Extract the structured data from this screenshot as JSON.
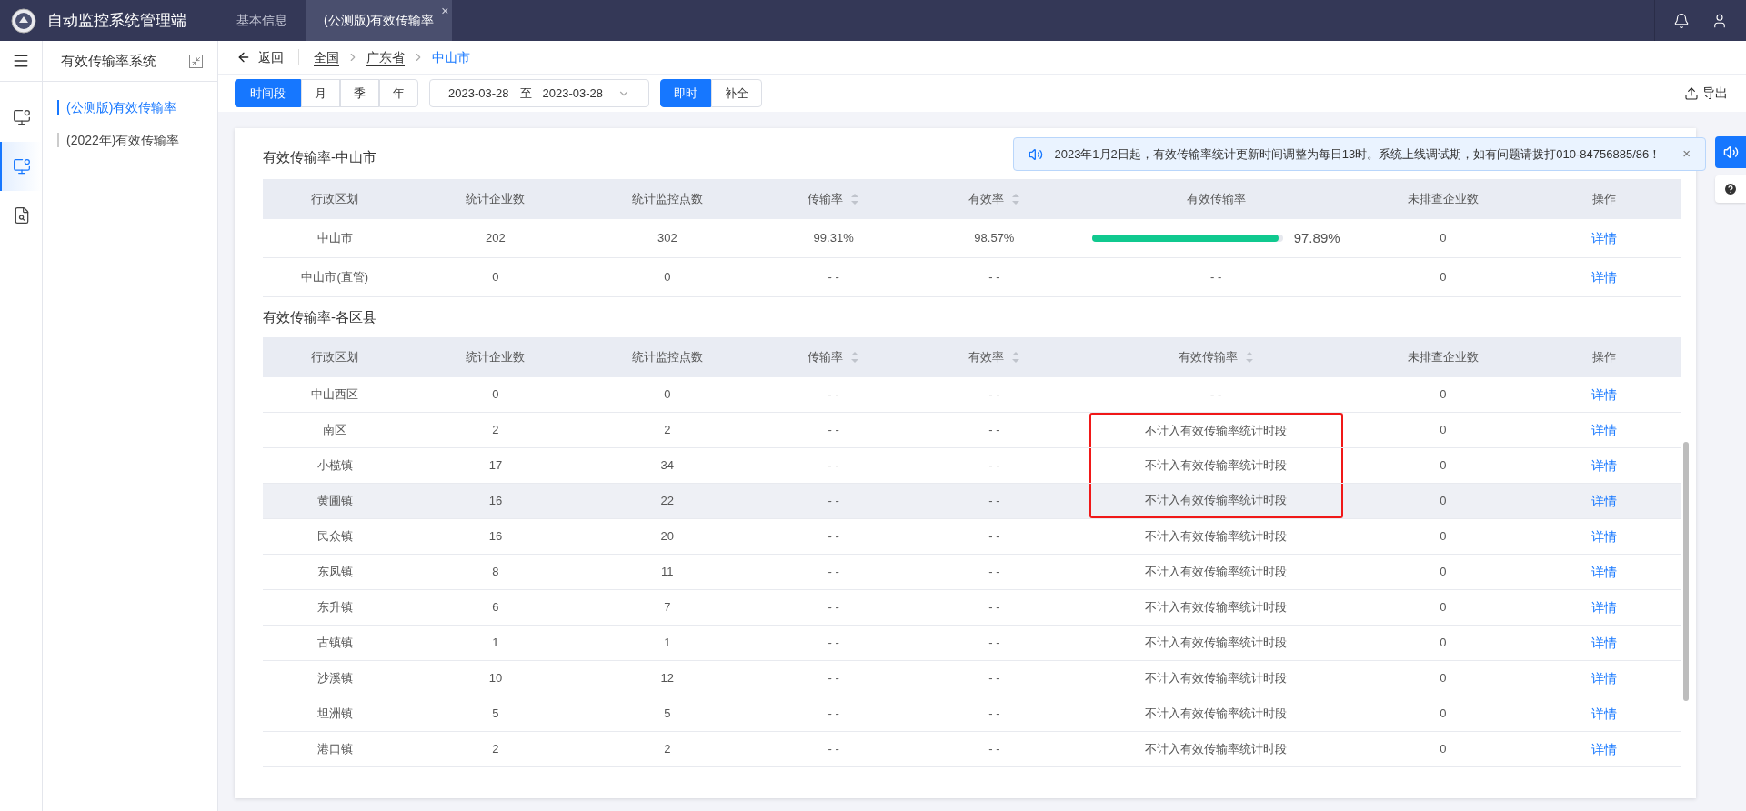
{
  "app": {
    "title": "自动监控系统管理端"
  },
  "tabs": [
    {
      "label": "基本信息",
      "selected": false
    },
    {
      "label": "(公测版)有效传输率",
      "selected": true,
      "close": "×"
    }
  ],
  "rail": [
    {
      "selected": false,
      "kind": "monitor"
    },
    {
      "selected": true,
      "kind": "monitor"
    },
    {
      "selected": false,
      "kind": "report"
    }
  ],
  "sidebar": {
    "title": "有效传输率系统",
    "items": [
      {
        "label": "(公测版)有效传输率",
        "selected": true
      },
      {
        "label": "(2022年)有效传输率",
        "selected": false
      }
    ]
  },
  "breadcrumb": {
    "back": "返回",
    "items": [
      {
        "label": "全国",
        "current": false
      },
      {
        "label": "广东省",
        "current": false
      },
      {
        "label": "中山市",
        "current": true
      }
    ]
  },
  "period_tabs": [
    {
      "label": "时间段",
      "selected": true
    },
    {
      "label": "月",
      "selected": false
    },
    {
      "label": "季",
      "selected": false
    },
    {
      "label": "年",
      "selected": false
    }
  ],
  "date_range": {
    "start": "2023-03-28",
    "separator": "至",
    "end": "2023-03-28"
  },
  "mode_tabs": [
    {
      "label": "即时",
      "selected": true
    },
    {
      "label": "补全",
      "selected": false
    }
  ],
  "export": "导出",
  "notice": {
    "text": "2023年1月2日起，有效传输率统计更新时间调整为每日13时。系统上线调试期，如有问题请拨打010-84756885/86！",
    "close": "×"
  },
  "tables": [
    {
      "title": "有效传输率-中山市",
      "columns": [
        {
          "label": "行政区划",
          "sortable": false
        },
        {
          "label": "统计企业数",
          "sortable": false
        },
        {
          "label": "统计监控点数",
          "sortable": false
        },
        {
          "label": "传输率",
          "sortable": true
        },
        {
          "label": "有效率",
          "sortable": true
        },
        {
          "label": "有效传输率",
          "sortable": false
        },
        {
          "label": "未排查企业数",
          "sortable": false
        },
        {
          "label": "操作",
          "sortable": false
        }
      ],
      "rows": [
        {
          "cells": [
            "中山市",
            "202",
            "302",
            "99.31%",
            "98.57%"
          ],
          "effective": {
            "text": "97.89%",
            "level": 0.9789
          },
          "unchecked": "0",
          "action": "详情"
        },
        {
          "cells": [
            "中山市(直管)",
            "0",
            "0",
            "- -",
            "- -"
          ],
          "effective": {
            "text": "- -"
          },
          "unchecked": "0",
          "action": "详情"
        }
      ]
    },
    {
      "title": "有效传输率-各区县",
      "columns": [
        {
          "label": "行政区划",
          "sortable": false
        },
        {
          "label": "统计企业数",
          "sortable": false
        },
        {
          "label": "统计监控点数",
          "sortable": false
        },
        {
          "label": "传输率",
          "sortable": true
        },
        {
          "label": "有效率",
          "sortable": true
        },
        {
          "label": "有效传输率",
          "sortable": true
        },
        {
          "label": "未排查企业数",
          "sortable": false
        },
        {
          "label": "操作",
          "sortable": false
        }
      ],
      "rows": [
        {
          "cells": [
            "中山西区",
            "0",
            "0",
            "- -",
            "- -"
          ],
          "effective": {
            "text": "- -"
          },
          "unchecked": "0",
          "action": "详情",
          "hovered": false,
          "highlighted": false
        },
        {
          "cells": [
            "南区",
            "2",
            "2",
            "- -",
            "- -"
          ],
          "effective": {
            "text": "不计入有效传输率统计时段"
          },
          "unchecked": "0",
          "action": "详情",
          "hovered": false,
          "highlighted": true
        },
        {
          "cells": [
            "小榄镇",
            "17",
            "34",
            "- -",
            "- -"
          ],
          "effective": {
            "text": "不计入有效传输率统计时段"
          },
          "unchecked": "0",
          "action": "详情",
          "hovered": false,
          "highlighted": true
        },
        {
          "cells": [
            "黄圃镇",
            "16",
            "22",
            "- -",
            "- -"
          ],
          "effective": {
            "text": "不计入有效传输率统计时段"
          },
          "unchecked": "0",
          "action": "详情",
          "hovered": true,
          "highlighted": true
        },
        {
          "cells": [
            "民众镇",
            "16",
            "20",
            "- -",
            "- -"
          ],
          "effective": {
            "text": "不计入有效传输率统计时段"
          },
          "unchecked": "0",
          "action": "详情",
          "hovered": false,
          "highlighted": false
        },
        {
          "cells": [
            "东凤镇",
            "8",
            "11",
            "- -",
            "- -"
          ],
          "effective": {
            "text": "不计入有效传输率统计时段"
          },
          "unchecked": "0",
          "action": "详情",
          "hovered": false,
          "highlighted": false
        },
        {
          "cells": [
            "东升镇",
            "6",
            "7",
            "- -",
            "- -"
          ],
          "effective": {
            "text": "不计入有效传输率统计时段"
          },
          "unchecked": "0",
          "action": "详情",
          "hovered": false,
          "highlighted": false
        },
        {
          "cells": [
            "古镇镇",
            "1",
            "1",
            "- -",
            "- -"
          ],
          "effective": {
            "text": "不计入有效传输率统计时段"
          },
          "unchecked": "0",
          "action": "详情",
          "hovered": false,
          "highlighted": false
        },
        {
          "cells": [
            "沙溪镇",
            "10",
            "12",
            "- -",
            "- -"
          ],
          "effective": {
            "text": "不计入有效传输率统计时段"
          },
          "unchecked": "0",
          "action": "详情",
          "hovered": false,
          "highlighted": false
        },
        {
          "cells": [
            "坦洲镇",
            "5",
            "5",
            "- -",
            "- -"
          ],
          "effective": {
            "text": "不计入有效传输率统计时段"
          },
          "unchecked": "0",
          "action": "详情",
          "hovered": false,
          "highlighted": false
        },
        {
          "cells": [
            "港口镇",
            "2",
            "2",
            "- -",
            "- -"
          ],
          "effective": {
            "text": "不计入有效传输率统计时段"
          },
          "unchecked": "0",
          "action": "详情",
          "hovered": false,
          "highlighted": false
        }
      ]
    }
  ]
}
